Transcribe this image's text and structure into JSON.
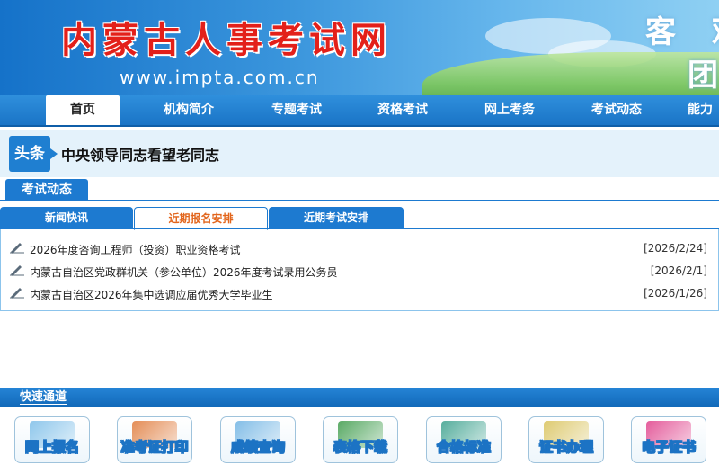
{
  "header": {
    "site_title": "内蒙古人事考试网",
    "url": "www.impta.com.cn",
    "slogan_line1": "客 观",
    "slogan_line2": "团"
  },
  "nav": {
    "items": [
      {
        "label": "首页",
        "active": true
      },
      {
        "label": "机构简介"
      },
      {
        "label": "专题考试"
      },
      {
        "label": "资格考试"
      },
      {
        "label": "网上考务"
      },
      {
        "label": "考试动态"
      },
      {
        "label": "能力"
      }
    ]
  },
  "headline": {
    "tag": "头条",
    "text": "中央领导同志看望老同志"
  },
  "news_section": {
    "title": "考试动态",
    "tabs": [
      {
        "label": "新闻快讯"
      },
      {
        "label": "近期报名安排",
        "active": true
      },
      {
        "label": "近期考试安排"
      }
    ],
    "items": [
      {
        "title": "2026年度咨询工程师（投资）职业资格考试",
        "date": "[2026/2/24]"
      },
      {
        "title": "内蒙古自治区党政群机关（参公单位）2026年度考试录用公务员",
        "date": "[2026/2/1]"
      },
      {
        "title": "内蒙古自治区2026年集中选调应届优秀大学毕业生",
        "date": "[2026/1/26]"
      }
    ]
  },
  "quick_access": {
    "title": "快速通道",
    "buttons": [
      {
        "label": "网上报名",
        "icon": "computer-icon",
        "color": "#7bbde8"
      },
      {
        "label": "准考证打印",
        "icon": "printer-icon",
        "color": "#e07a3a"
      },
      {
        "label": "成绩查询",
        "icon": "search-icon",
        "color": "#6fb3e3"
      },
      {
        "label": "表格下载",
        "icon": "spreadsheet-icon",
        "color": "#3d9b4a"
      },
      {
        "label": "合格标准",
        "icon": "chart-icon",
        "color": "#3aa08c"
      },
      {
        "label": "证书办理",
        "icon": "certificate-icon",
        "color": "#d9c25a"
      },
      {
        "label": "电子证书",
        "icon": "pdf-icon",
        "color": "#e0408a"
      }
    ]
  }
}
